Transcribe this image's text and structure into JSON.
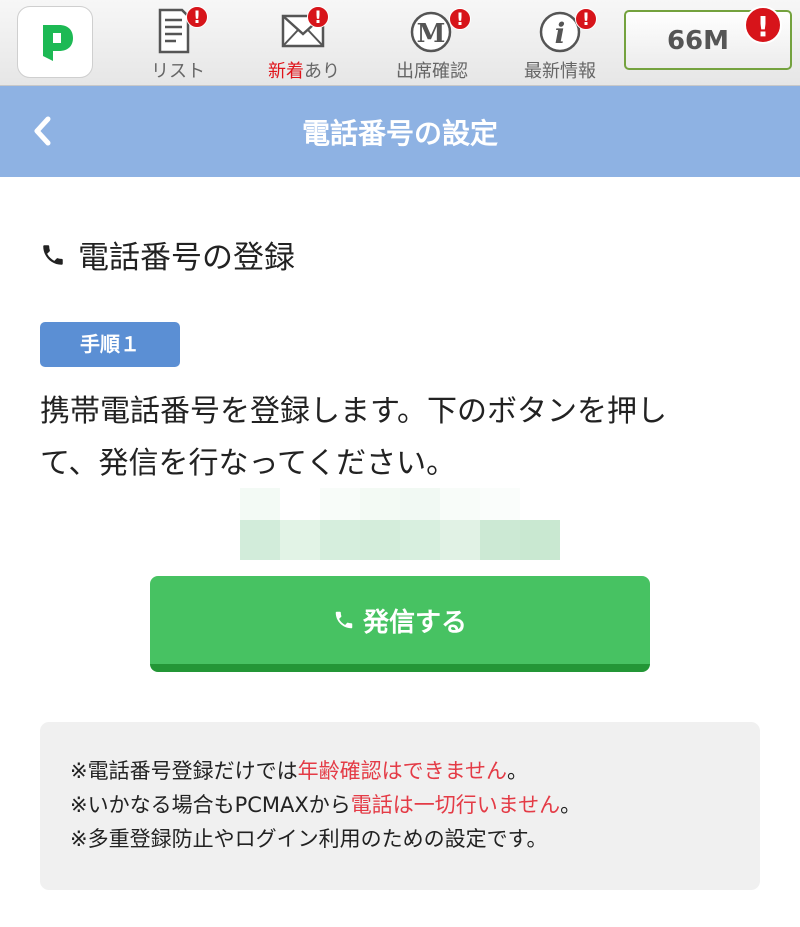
{
  "topnav": {
    "logo_letter": "P",
    "items": [
      {
        "label": "リスト",
        "icon": "list-document-icon",
        "badge": "!"
      },
      {
        "label_highlight": "新着",
        "label_rest": "あり",
        "icon": "envelope-icon",
        "badge": "!"
      },
      {
        "label": "出席確認",
        "icon": "attendance-m-icon",
        "badge": "!"
      },
      {
        "label": "最新情報",
        "icon": "info-icon",
        "badge": "!"
      }
    ],
    "points": "66M",
    "points_badge": "!"
  },
  "titlebar": {
    "title": "電話番号の設定"
  },
  "content": {
    "section_heading": "電話番号の登録",
    "step_badge": "手順１",
    "instruction_line1": "携帯電話番号を登録します。下のボタンを押し",
    "instruction_line2": "て、発信を行なってください。",
    "call_button": "発信する"
  },
  "notice": {
    "line1_pre": "※電話番号登録だけでは",
    "line1_hl": "年齢確認はできません",
    "line1_post": "。",
    "line2_pre": "※いかなる場合もPCMAXから",
    "line2_hl": "電話は一切行いません",
    "line2_post": "。",
    "line3": "※多重登録防止やログイン利用のための設定です。"
  },
  "colors": {
    "titlebar": "#8eb2e3",
    "call_button": "#47c262",
    "step_badge": "#5b8fd4",
    "highlight": "#e43b46",
    "alert": "#d7141a"
  }
}
